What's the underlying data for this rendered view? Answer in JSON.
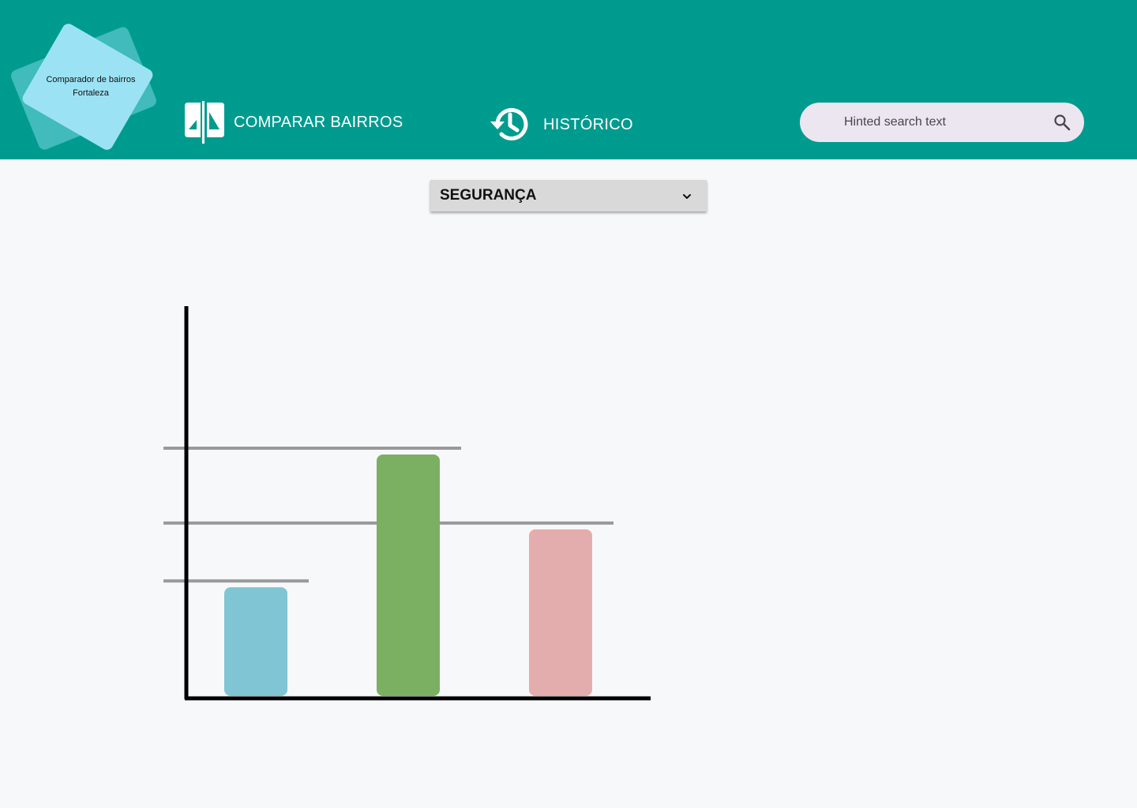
{
  "app": {
    "logo_line1": "Comparador de bairros",
    "logo_line2": "Fortaleza"
  },
  "nav": {
    "compare_label": "COMPARAR BAIRROS",
    "compare_icon": "compare-icon",
    "history_label": "HISTÓRICO",
    "history_icon": "history-icon"
  },
  "search": {
    "placeholder": "Hinted search text",
    "icon": "search-icon"
  },
  "category_select": {
    "selected": "SEGURANÇA",
    "icon": "chevron-down-icon"
  },
  "colors": {
    "header": "#009b8f",
    "bar1": "#7fc5d4",
    "bar2": "#7baf61",
    "bar3": "#e4adad",
    "reference_line": "#999999"
  },
  "chart_data": {
    "type": "bar",
    "values": [
      0.45,
      1.0,
      0.69
    ],
    "colors": [
      "#7fc5d4",
      "#7baf61",
      "#e4adad"
    ],
    "ylim": [
      0,
      1.6
    ],
    "reference_lines": true
  }
}
